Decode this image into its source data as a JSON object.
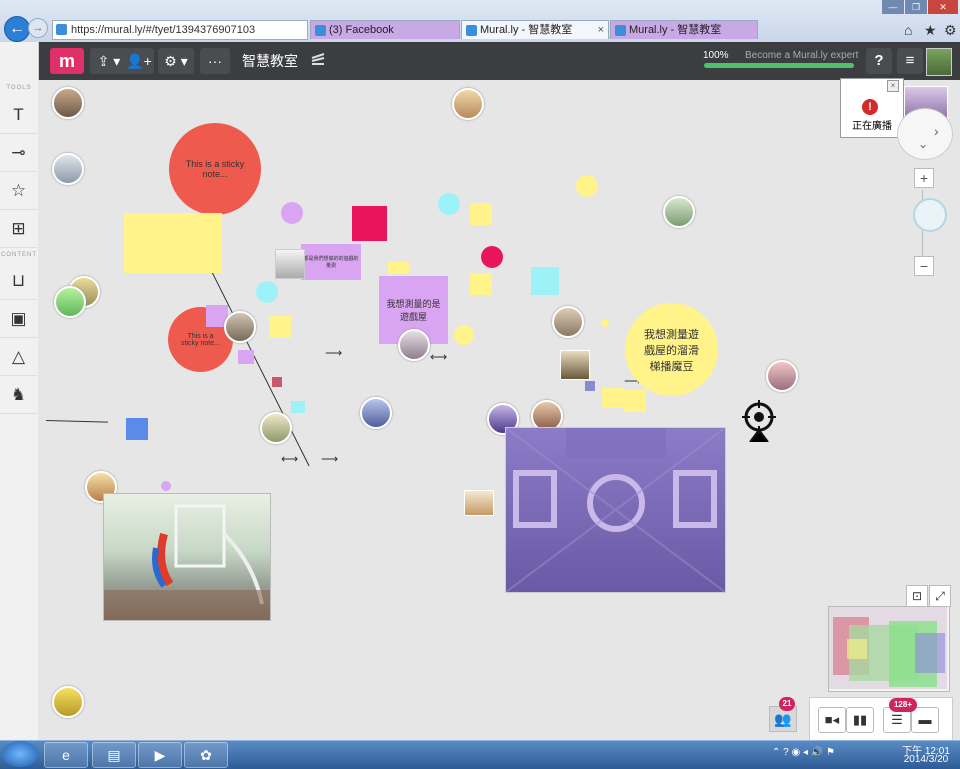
{
  "browser": {
    "url": "https://mural.ly/#/tyet/1394376907103",
    "tabs": [
      {
        "label": "(3) Facebook"
      },
      {
        "label": "Mural.ly - 智慧教室"
      },
      {
        "label": "Mural.ly - 智慧教室"
      }
    ],
    "close_glyph": "×",
    "back_glyph": "←",
    "fwd_glyph": "→"
  },
  "toolbar": {
    "logo": "m",
    "share_label": "⇪ ▾",
    "add_user_label": "👤+",
    "settings_label": "⚙ ▾",
    "more_label": "···",
    "board_title": "智慧教室",
    "cast_icon": "cast-icon",
    "progress_label": "100%",
    "progress_value": 1.0,
    "expert_label": "Become a Mural.ly expert",
    "help_label": "?",
    "menu_label": "≡"
  },
  "sidebar": {
    "tools_heading": "TOOLS",
    "content_heading": "CONTENT",
    "tools": [
      {
        "icon": "text-icon",
        "glyph": "T"
      },
      {
        "icon": "connector-icon",
        "glyph": "⊸"
      },
      {
        "icon": "star-icon",
        "glyph": "☆"
      },
      {
        "icon": "grid-icon",
        "glyph": "⊞"
      }
    ],
    "content": [
      {
        "icon": "inbox-icon",
        "glyph": "⊔"
      },
      {
        "icon": "image-icon",
        "glyph": "▣"
      },
      {
        "icon": "drive-icon",
        "glyph": "△"
      },
      {
        "icon": "evernote-icon",
        "glyph": "♞"
      }
    ]
  },
  "canvas": {
    "notes": {
      "red_circle_1": "This is a sticky note...",
      "red_circle_2": "This is a sticky note...",
      "purple_note": "我想測量的是遊戲屋",
      "yellow_circle": "我想測量遊戲屋的溜滑梯播魔豆",
      "purple_small": "都是我們想做的的遊戲的量測"
    }
  },
  "broadcast": {
    "label": "正在廣播",
    "icon_glyph": "!"
  },
  "zoom": {
    "plus": "+",
    "minus": "−"
  },
  "bottom": {
    "users_count": "21",
    "outline_count": "128+",
    "video_glyph": "■◂",
    "panels_glyph": "▮▮",
    "outline_glyph": "☰",
    "chat_glyph": "▬",
    "users_glyph": "👥",
    "fit_glyph": "⊡",
    "expand_glyph": "⤢"
  },
  "taskbar": {
    "time": "下午 12:01",
    "date": "2014/3/20",
    "tray_glyphs": "⌃ ? ◉ ◂ 🔊 ⚑"
  },
  "colors": {
    "accent": "#e0306a",
    "toolbar_bg": "#3b3d40",
    "sticky_red": "#ef5a4f",
    "sticky_yellow": "#fff38a",
    "sticky_purple": "#d9a5f2",
    "sticky_cyan": "#9cf2f6",
    "sticky_magenta": "#e8145c"
  }
}
